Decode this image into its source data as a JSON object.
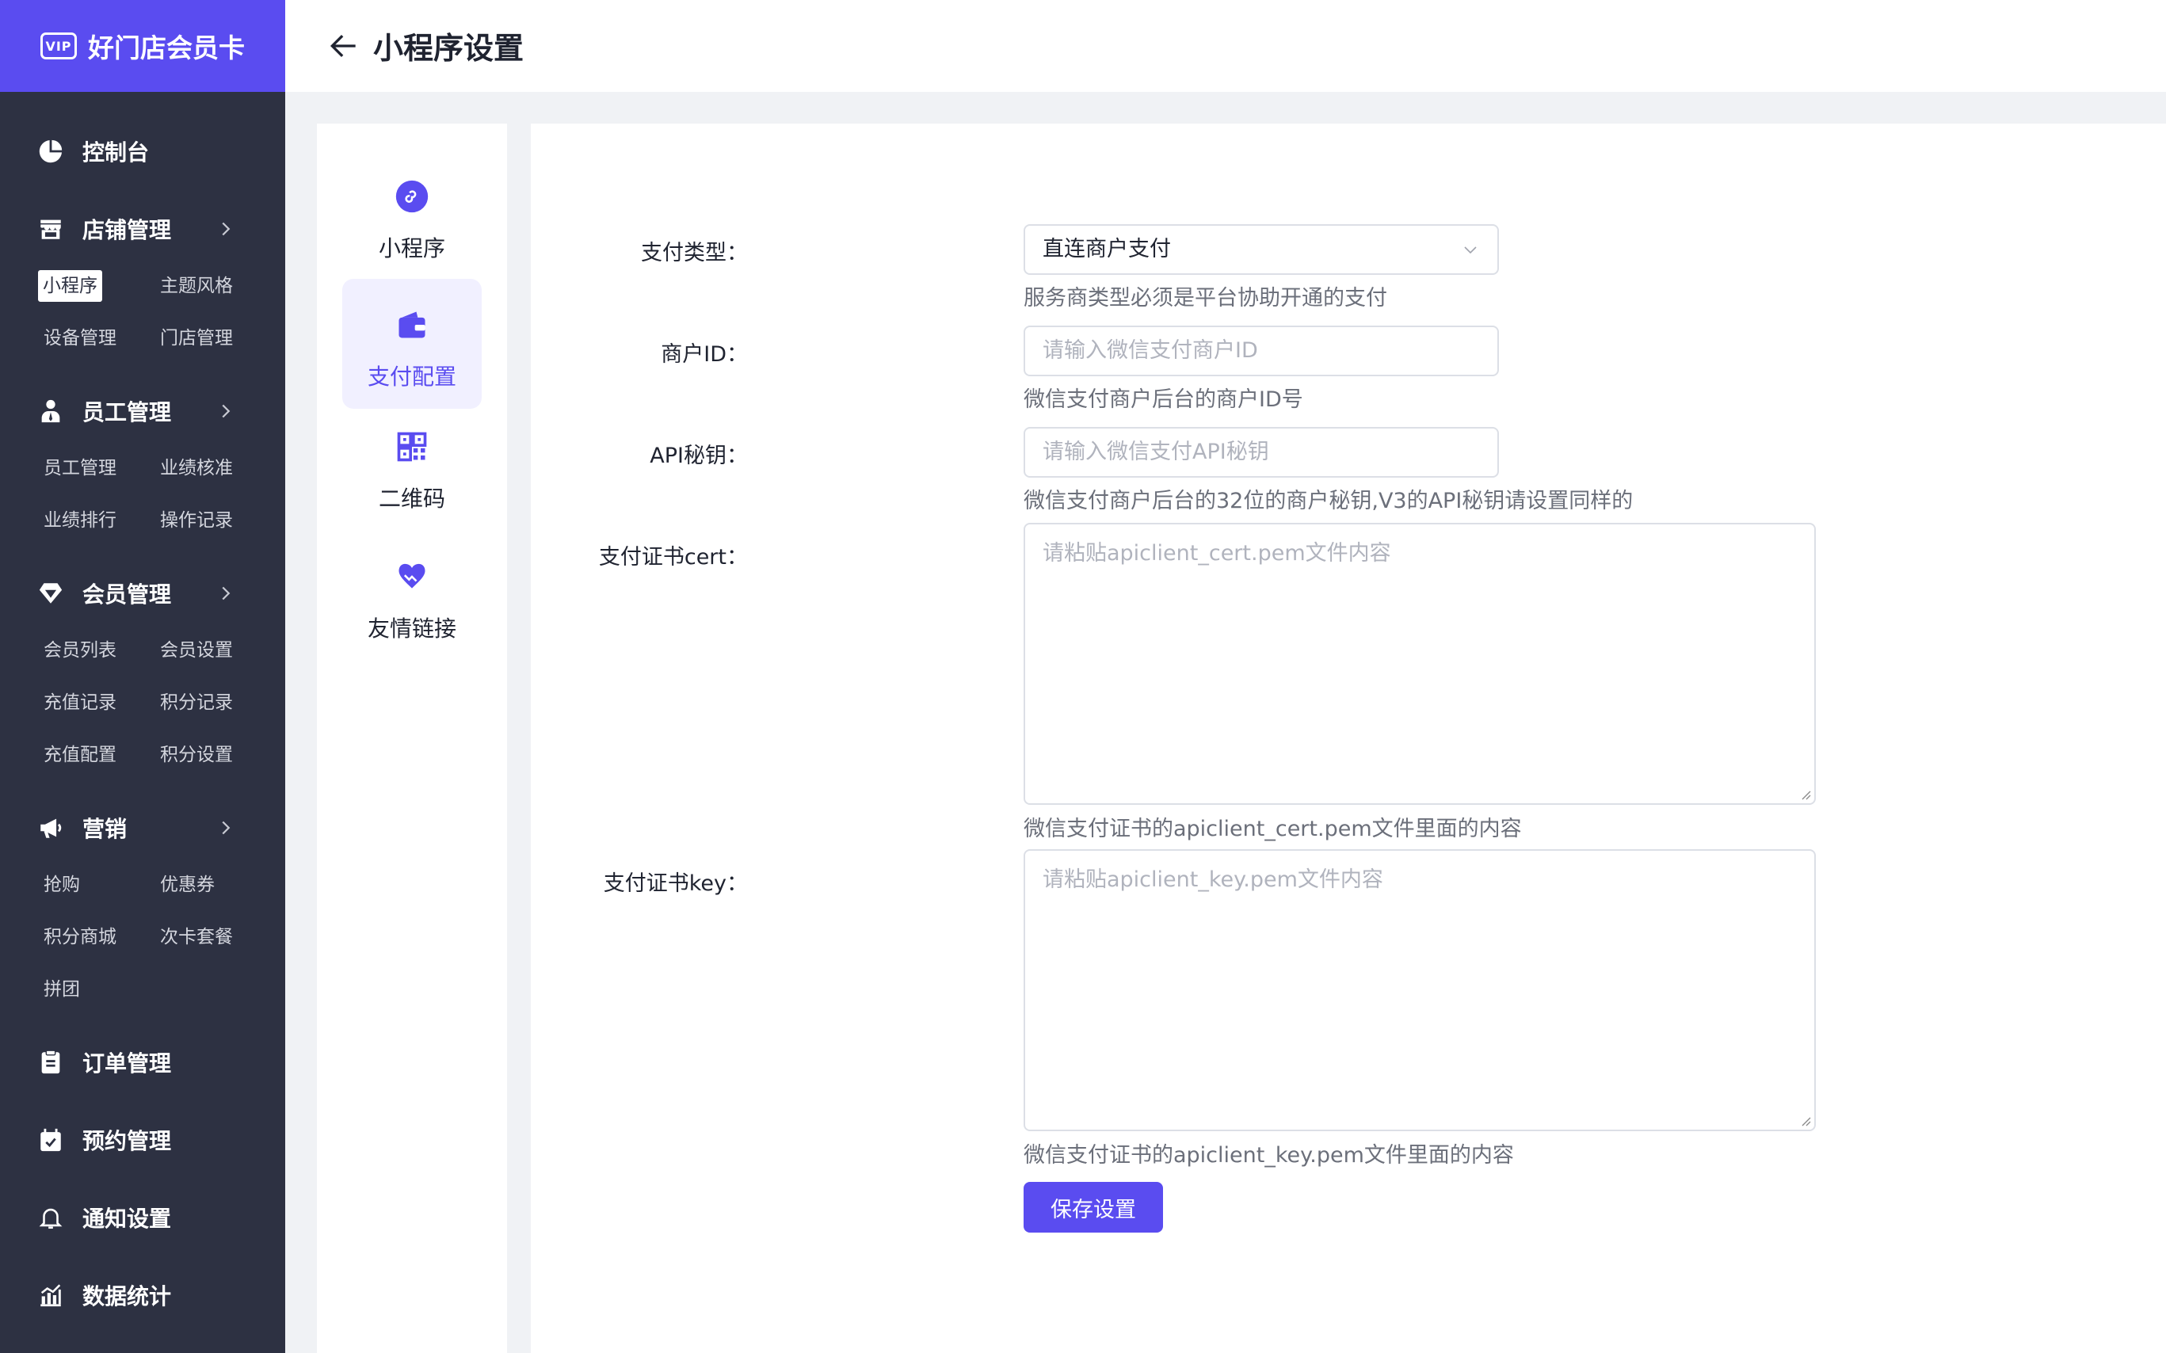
{
  "brand": {
    "badge": "VIP",
    "name": "好门店会员卡"
  },
  "page": {
    "title": "小程序设置"
  },
  "sidebar": {
    "dashboard": "控制台",
    "store": {
      "label": "店铺管理",
      "items": [
        "小程序",
        "主题风格",
        "设备管理",
        "门店管理"
      ],
      "active": "小程序"
    },
    "staff": {
      "label": "员工管理",
      "items": [
        "员工管理",
        "业绩核准",
        "业绩排行",
        "操作记录"
      ]
    },
    "member": {
      "label": "会员管理",
      "items": [
        "会员列表",
        "会员设置",
        "充值记录",
        "积分记录",
        "充值配置",
        "积分设置"
      ]
    },
    "marketing": {
      "label": "营销",
      "items": [
        "抢购",
        "优惠券",
        "积分商城",
        "次卡套餐",
        "拼团"
      ]
    },
    "orders": "订单管理",
    "booking": "预约管理",
    "notify": "通知设置",
    "stats": "数据统计"
  },
  "subnav": [
    {
      "label": "小程序",
      "icon": "mini-program-icon"
    },
    {
      "label": "支付配置",
      "icon": "wallet-icon",
      "selected": true
    },
    {
      "label": "二维码",
      "icon": "qrcode-icon"
    },
    {
      "label": "友情链接",
      "icon": "handshake-heart-icon"
    }
  ],
  "form": {
    "pay_type": {
      "label": "支付类型",
      "value": "直连商户支付",
      "hint": "服务商类型必须是平台协助开通的支付"
    },
    "merchant_id": {
      "label": "商户ID",
      "placeholder": "请输入微信支付商户ID",
      "value": "",
      "hint": "微信支付商户后台的商户ID号"
    },
    "api_key": {
      "label": "API秘钥",
      "placeholder": "请输入微信支付API秘钥",
      "value": "",
      "hint": "微信支付商户后台的32位的商户秘钥,V3的API秘钥请设置同样的"
    },
    "cert": {
      "label": "支付证书cert",
      "placeholder": "请粘贴apiclient_cert.pem文件内容",
      "value": "",
      "hint": "微信支付证书的apiclient_cert.pem文件里面的内容"
    },
    "key": {
      "label": "支付证书key",
      "placeholder": "请粘贴apiclient_key.pem文件内容",
      "value": "",
      "hint": "微信支付证书的apiclient_key.pem文件里面的内容"
    },
    "colon": "："
  },
  "save_label": "保存设置",
  "colors": {
    "accent": "#5a4cf0",
    "sidebar": "#2d3142",
    "background": "#f0f2f5"
  }
}
